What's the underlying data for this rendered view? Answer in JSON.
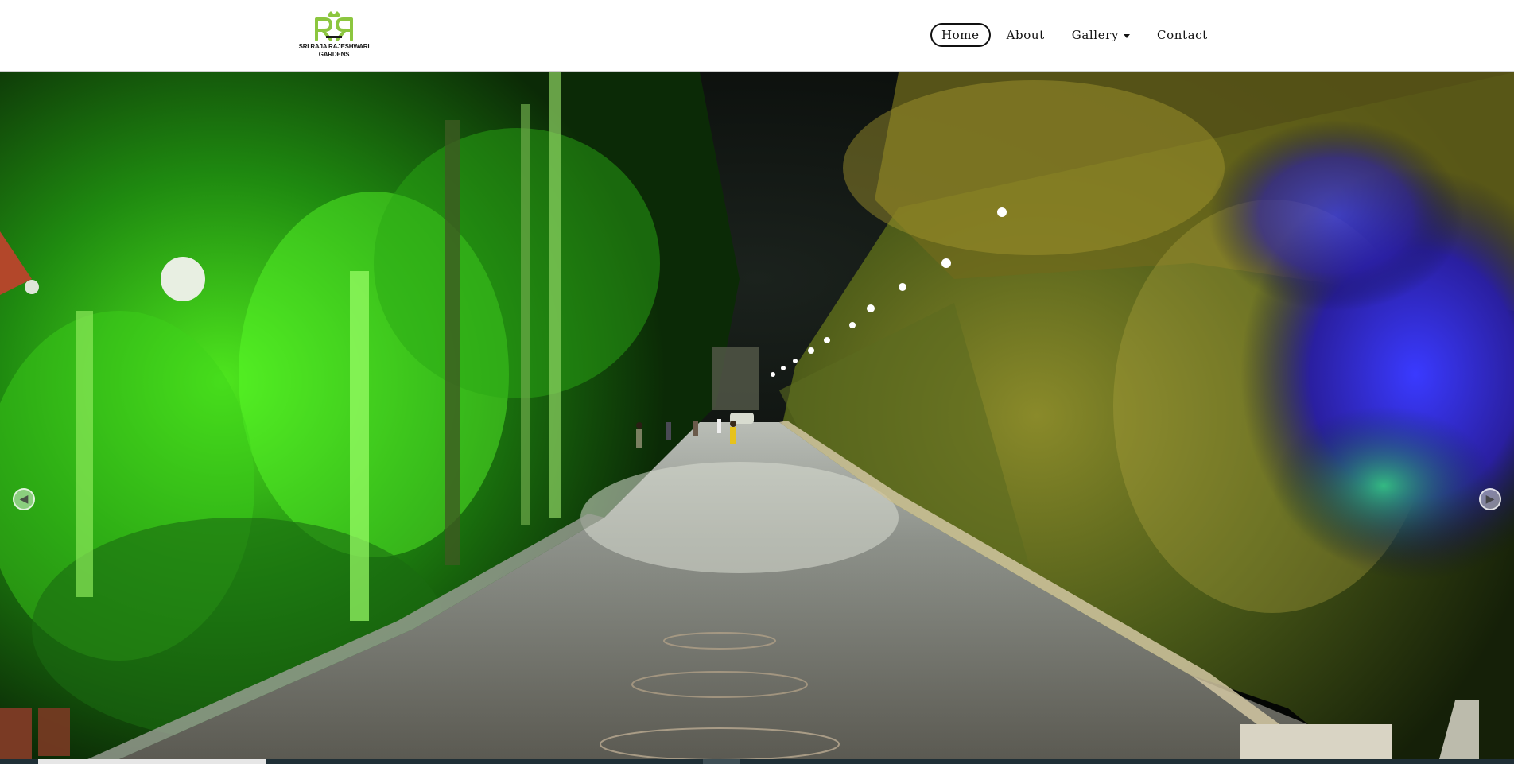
{
  "brand": {
    "monogram": "RR",
    "name_line1": "SRI RAJA RAJESHWARI",
    "name_line2": "GARDENS",
    "accent_color": "#8cc63f"
  },
  "nav": {
    "items": [
      {
        "label": "Home",
        "active": true
      },
      {
        "label": "About",
        "active": false
      },
      {
        "label": "Gallery",
        "active": false,
        "has_dropdown": true
      },
      {
        "label": "Contact",
        "active": false
      }
    ]
  },
  "slider": {
    "prev_icon": "arrow-left-circle-icon",
    "next_icon": "arrow-right-circle-icon",
    "progress": 0.15,
    "image_description_icon": "photo"
  }
}
